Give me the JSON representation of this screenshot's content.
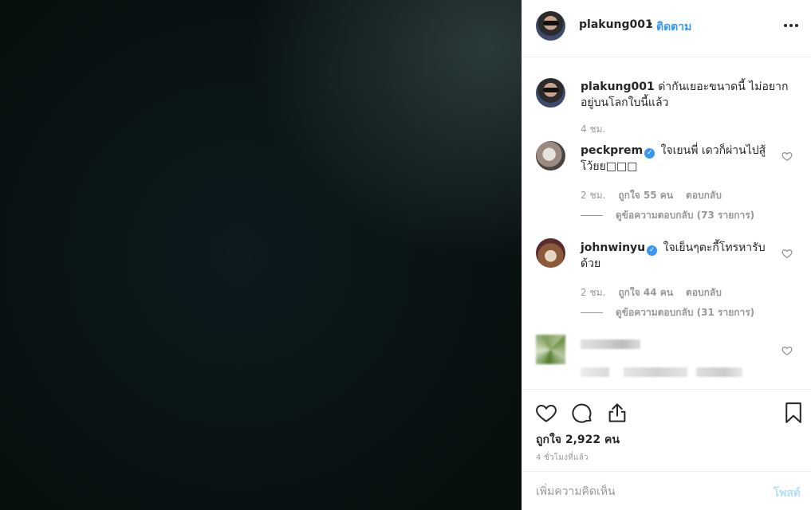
{
  "post": {
    "username": "plakung001",
    "separator": "•",
    "follow_label": "ติดตาม"
  },
  "caption": {
    "username": "plakung001",
    "text": "ด่ากันเยอะขนาดนี้ ไม่อยากอยู่บนโลกใบนี้แล้ว",
    "time": "4 ชม."
  },
  "comments": [
    {
      "username": "peckprem",
      "verified": true,
      "text": "ใจเยนพี่ เดวก็ผ่านไปสู้โว้ยย□□□",
      "time": "2 ชม.",
      "likes": "ถูกใจ 55 คน",
      "reply_label": "ตอบกลับ",
      "view_replies": "ดูข้อความตอบกลับ (73 รายการ)"
    },
    {
      "username": "johnwinyu",
      "verified": true,
      "text": "ใจเย็นๆตะกี้โทรหารับด้วย",
      "time": "2 ชม.",
      "likes": "ถูกใจ 44 คน",
      "reply_label": "ตอบกลับ",
      "view_replies": "ดูข้อความตอบกลับ (31 รายการ)"
    }
  ],
  "actions": {
    "likes_text": "ถูกใจ 2,922 คน",
    "time_ago": "4 ชั่วโมงที่แล้ว"
  },
  "add_comment": {
    "placeholder": "เพิ่มความคิดเห็น",
    "post_label": "โพสต์"
  },
  "icons": {
    "verified": "verified-badge-icon",
    "heart": "heart-icon",
    "comment": "comment-icon",
    "share": "share-icon",
    "bookmark": "bookmark-icon",
    "more": "more-options-icon"
  },
  "colors": {
    "link": "#3897f0",
    "muted": "#999999",
    "post_disabled": "#b2dffc",
    "text": "#262626"
  }
}
